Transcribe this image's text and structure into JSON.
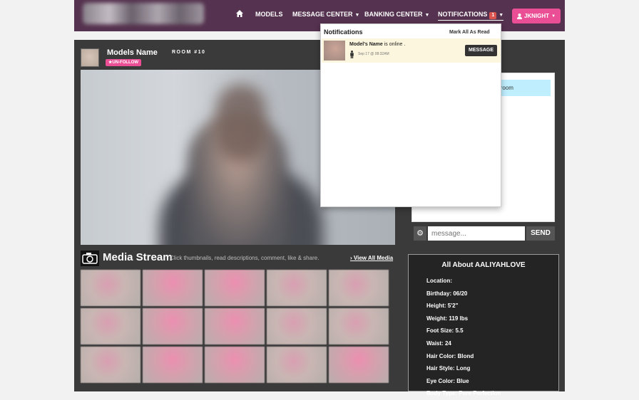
{
  "nav": {
    "items": [
      {
        "label": "MODELS"
      },
      {
        "label": "MESSAGE CENTER"
      },
      {
        "label": "BANKING CENTER"
      },
      {
        "label": "NOTIFICATIONS"
      }
    ],
    "notification_count": "1",
    "user_label": "JKNIGHT"
  },
  "model": {
    "name": "Models Name",
    "room": "ROOM #10",
    "unfollow_label": "UN-FOLLOW"
  },
  "media": {
    "title": "Media Stream",
    "description": "Click thumbnails, read descriptions, comment, like & share.",
    "view_all": "View All Media"
  },
  "chat": {
    "message_fragment": "e room",
    "input_placeholder": "message...",
    "send_label": "SEND"
  },
  "about": {
    "title": "All About AALIYAHLOVE",
    "rows": [
      {
        "label": "Location:",
        "value": ""
      },
      {
        "label": "Birthday:",
        "value": "06/20"
      },
      {
        "label": "Height:",
        "value": "5'2\""
      },
      {
        "label": "Weight:",
        "value": "119 lbs"
      },
      {
        "label": "Foot Size:",
        "value": "5.5"
      },
      {
        "label": "Waist:",
        "value": "24"
      },
      {
        "label": "Hair Color:",
        "value": "Blond"
      },
      {
        "label": "Hair Style:",
        "value": "Long"
      },
      {
        "label": "Eye Color:",
        "value": "Blue"
      },
      {
        "label": "Body Type:",
        "value": "Pure Perfection"
      }
    ]
  },
  "notifications": {
    "title": "Notifications",
    "mark_all": "Mark All As Read",
    "item": {
      "name": "Model's Name",
      "text": "is online .",
      "time": "Sep 17 @ 08:32AM",
      "button": "MESSAGE"
    }
  }
}
